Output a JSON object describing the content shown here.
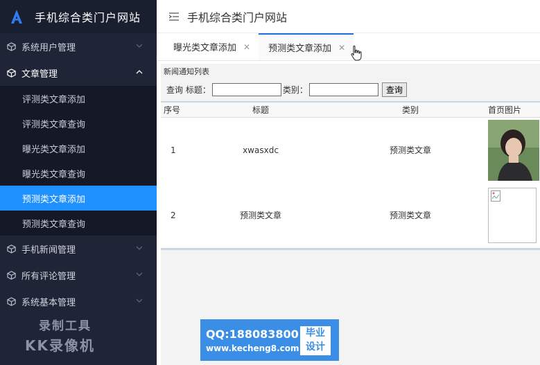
{
  "app": {
    "brand_title": "手机综合类门户网站",
    "header_title": "手机综合类门户网站"
  },
  "sidebar": {
    "groups": [
      {
        "label": "系统用户管理",
        "open": false
      },
      {
        "label": "文章管理",
        "open": true,
        "items": [
          {
            "label": "评测类文章添加",
            "active": false
          },
          {
            "label": "评测类文章查询",
            "active": false
          },
          {
            "label": "曝光类文章添加",
            "active": false
          },
          {
            "label": "曝光类文章查询",
            "active": false
          },
          {
            "label": "预测类文章添加",
            "active": true
          },
          {
            "label": "预测类文章查询",
            "active": false
          }
        ]
      },
      {
        "label": "手机新闻管理",
        "open": false
      },
      {
        "label": "所有评论管理",
        "open": false
      },
      {
        "label": "系统基本管理",
        "open": false
      }
    ],
    "watermark_line1": "录制工具",
    "watermark_line2": "KK录像机"
  },
  "tabs": [
    {
      "label": "曝光类文章添加",
      "close": "✕",
      "active": false
    },
    {
      "label": "预测类文章添加",
      "close": "✕",
      "active": true
    }
  ],
  "panel": {
    "title": "新闻通知列表",
    "search": {
      "prefix": "查询 标题：",
      "title_value": "",
      "category_label": "类别：",
      "category_value": "",
      "button": "查询"
    },
    "table": {
      "headers": [
        "序号",
        "标题",
        "类别",
        "首页图片"
      ],
      "rows": [
        {
          "no": "1",
          "title": "xwasxdc",
          "category": "预测类文章",
          "image": "photo"
        },
        {
          "no": "2",
          "title": "预测类文章",
          "category": "预测类文章",
          "image": "broken"
        }
      ]
    }
  },
  "banner": {
    "qq": "QQ:188083800",
    "site": "www.kecheng8.com",
    "badge_line1": "毕业",
    "badge_line2": "设计"
  },
  "colors": {
    "sidebar_bg": "#1f2436",
    "active_item": "#1e90ff",
    "tab_accent": "#1e6fd9",
    "banner_bg": "#3a8ee6"
  }
}
